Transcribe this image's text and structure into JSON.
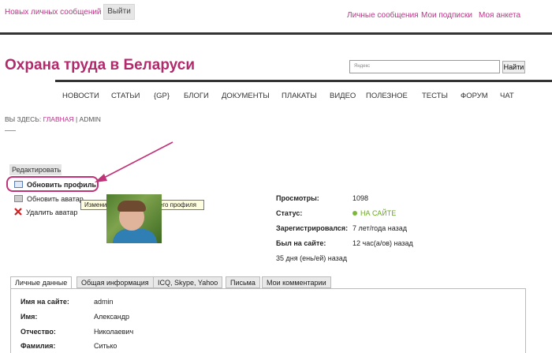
{
  "topbar": {
    "no_messages": "Новых личных сообщений нет",
    "exit_label": "Выйти",
    "links": [
      "Личные сообщения",
      "Мои подписки",
      "Моя анкета"
    ]
  },
  "site": {
    "title": "Охрана труда в Беларуси"
  },
  "search": {
    "placeholder": "Яндекс",
    "button": "Найти"
  },
  "nav": [
    "НОВОСТИ",
    "СТАТЬИ",
    "{GP}",
    "БЛОГИ",
    "ДОКУМЕНТЫ",
    "ПЛАКАТЫ",
    "ВИДЕО",
    "ПОЛЕЗНОЕ",
    "ТЕСТЫ",
    "ФОРУМ",
    "ЧАТ"
  ],
  "breadcrumb": {
    "prefix": "ВЫ ЗДЕСЬ:",
    "home": "ГЛАВНАЯ",
    "sep": "|",
    "current": "ADMIN"
  },
  "edit_menu": {
    "title": "Редактировать",
    "items": [
      "Обновить профиль",
      "Обновить аватар",
      "Удалить аватар"
    ],
    "tooltip": "Измените настройки Вашего профиля"
  },
  "stats": {
    "views_label": "Просмотры:",
    "views": "1098",
    "status_label": "Статус:",
    "status": "НА САЙТЕ",
    "registered_label": "Зарегистрировался:",
    "registered": "7 лет/года назад",
    "last_seen_label": "Был на сайте:",
    "last_seen": "12 час(а/ов) назад",
    "extra": "35 дня (ень/ей) назад"
  },
  "tabs": [
    "Личные данные",
    "Общая информация",
    "ICQ, Skype, Yahoo",
    "Письма",
    "Мои комментарии"
  ],
  "profile": [
    {
      "key": "Имя на сайте:",
      "value": "admin"
    },
    {
      "key": "Имя:",
      "value": "Александр"
    },
    {
      "key": "Отчество:",
      "value": "Николаевич"
    },
    {
      "key": "Фамилия:",
      "value": "Ситько"
    }
  ],
  "colors": {
    "accent": "#c0308a",
    "title": "#b02a6c",
    "online": "#6aaa1e"
  }
}
